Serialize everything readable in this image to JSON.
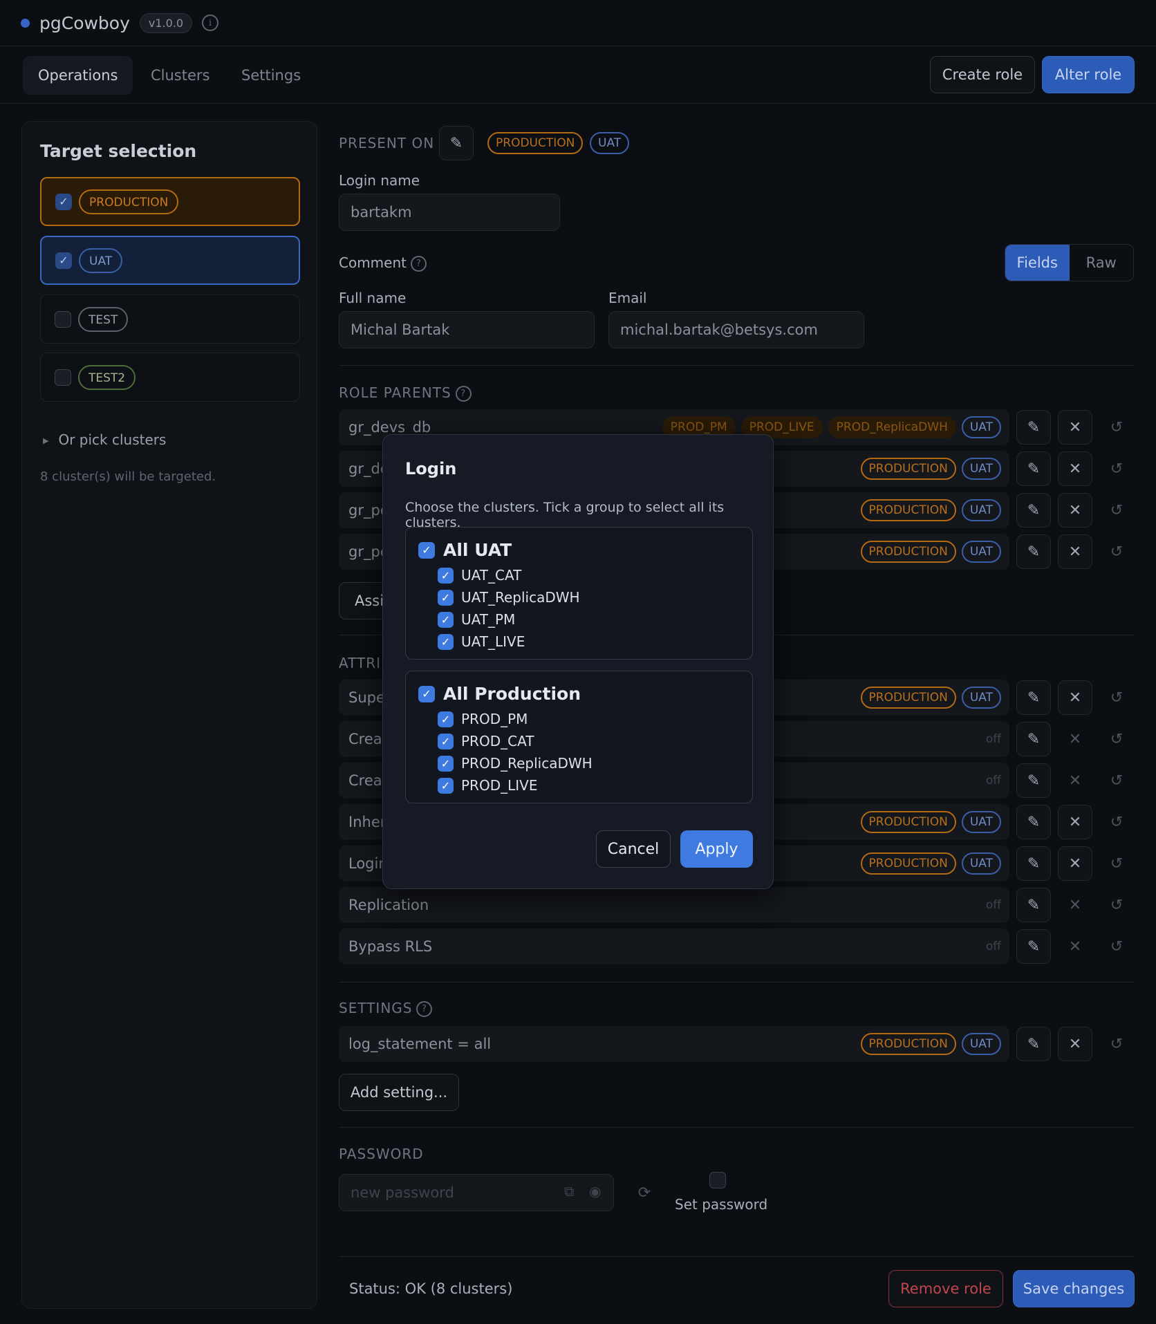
{
  "app": {
    "name": "pgCowboy",
    "version": "v1.0.0"
  },
  "nav": {
    "tabs": [
      "Operations",
      "Clusters",
      "Settings"
    ],
    "create_role": "Create role",
    "alter_role": "Alter role"
  },
  "sidebar": {
    "title": "Target selection",
    "targets": [
      {
        "label": "PRODUCTION",
        "checked": true
      },
      {
        "label": "UAT",
        "checked": true
      },
      {
        "label": "TEST",
        "checked": false
      },
      {
        "label": "TEST2",
        "checked": false
      }
    ],
    "pick_clusters": "Or pick clusters",
    "targeted": "8 cluster(s) will be targeted."
  },
  "main": {
    "present_on": "PRESENT ON",
    "present_tags": [
      "PRODUCTION",
      "UAT"
    ],
    "login_name_label": "Login name",
    "login_name_value": "bartakm",
    "comment_label": "Comment",
    "view_toggle": [
      "Fields",
      "Raw"
    ],
    "full_name_label": "Full name",
    "full_name_value": "Michal Bartak",
    "email_label": "Email",
    "email_value": "michal.bartak@betsys.com",
    "role_parents_label": "ROLE PARENTS",
    "role_parents": [
      {
        "name": "gr_devs_db",
        "tags": [
          "PROD_PM",
          "PROD_LIVE",
          "PROD_ReplicaDWH"
        ],
        "tag2": "UAT"
      },
      {
        "name": "gr_de",
        "tags": [
          "PRODUCTION"
        ],
        "tag2": "UAT"
      },
      {
        "name": "gr_pe",
        "tags": [
          "PRODUCTION"
        ],
        "tag2": "UAT"
      },
      {
        "name": "gr_pe",
        "tags": [
          "PRODUCTION"
        ],
        "tag2": "UAT"
      }
    ],
    "assign_btn": "Assi",
    "attributes_label": "ATTRIB",
    "attributes": [
      {
        "name": "Supe",
        "tags": [
          "PRODUCTION",
          "UAT"
        ],
        "off": ""
      },
      {
        "name": "Creat",
        "tags": [],
        "off": "off"
      },
      {
        "name": "Creat",
        "tags": [],
        "off": "off"
      },
      {
        "name": "Inher",
        "tags": [
          "PRODUCTION",
          "UAT"
        ],
        "off": ""
      },
      {
        "name": "Login",
        "tags": [
          "PRODUCTION",
          "UAT"
        ],
        "off": ""
      },
      {
        "name": "Replication",
        "tags": [],
        "off": "off"
      },
      {
        "name": "Bypass RLS",
        "tags": [],
        "off": "off"
      }
    ],
    "settings_label": "SETTINGS",
    "setting_row": {
      "name": "log_statement = all",
      "tags": [
        "PRODUCTION",
        "UAT"
      ]
    },
    "add_setting": "Add setting...",
    "password_label": "PASSWORD",
    "password_placeholder": "new password",
    "set_password": "Set password",
    "status": "Status: OK (8 clusters)",
    "remove_role": "Remove role",
    "save_changes": "Save changes"
  },
  "modal": {
    "title": "Login",
    "description": "Choose the clusters. Tick a group to select all its clusters.",
    "groups": [
      {
        "name": "All UAT",
        "clusters": [
          "UAT_CAT",
          "UAT_ReplicaDWH",
          "UAT_PM",
          "UAT_LIVE"
        ]
      },
      {
        "name": "All Production",
        "clusters": [
          "PROD_PM",
          "PROD_CAT",
          "PROD_ReplicaDWH",
          "PROD_LIVE"
        ]
      }
    ],
    "cancel": "Cancel",
    "apply": "Apply"
  }
}
